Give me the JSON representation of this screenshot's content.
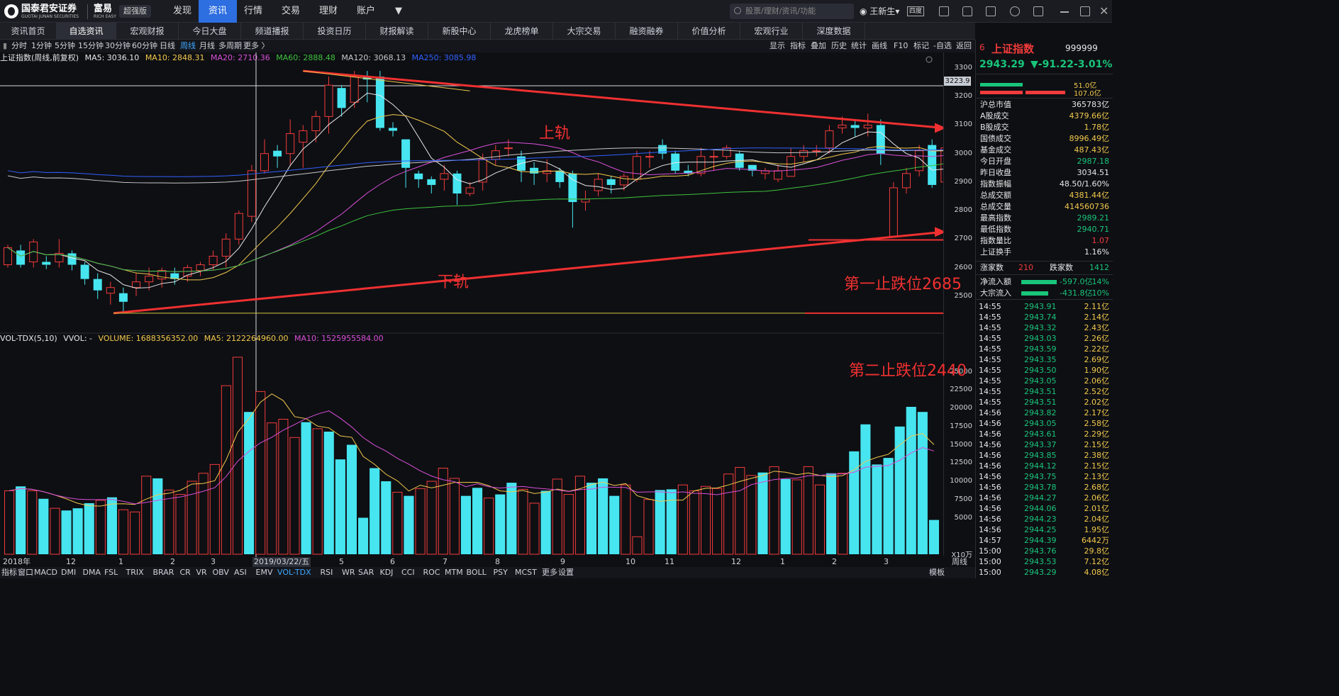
{
  "brand": {
    "name": "国泰君安证券",
    "sub": "GUOTAI JUNAN SECURITIES",
    "app": "富易",
    "app_sub": "RICH EASY",
    "edition": "超强版"
  },
  "top_menu": [
    "发现",
    "资讯",
    "行情",
    "交易",
    "理财",
    "账户"
  ],
  "search": {
    "placeholder": "股票/理财/资讯/功能"
  },
  "user": {
    "name": "王新生",
    "badge": "四度"
  },
  "sub_nav": [
    "资讯首页",
    "自选资讯",
    "宏观财报",
    "今日大盘",
    "频道播报",
    "投资日历",
    "财报解读",
    "新股中心",
    "龙虎榜单",
    "大宗交易",
    "融资融券",
    "价值分析",
    "宏观行业",
    "深度数据"
  ],
  "periods": [
    "分时",
    "1分钟",
    "5分钟",
    "15分钟",
    "30分钟",
    "60分钟",
    "日线",
    "周线",
    "月线",
    "多周期",
    "更多 〉"
  ],
  "right_tools": [
    "显示",
    "指标",
    "叠加",
    "历史",
    "统计",
    "画线",
    "F10",
    "标记",
    "-自选",
    "返回"
  ],
  "ma_line": {
    "title": "上证指数(周线,前复权)",
    "ma5": "MA5: 3036.10",
    "ma10": "MA10: 2848.31",
    "ma20": "MA20: 2710.36",
    "ma60": "MA60: 2888.48",
    "ma120": "MA120: 3068.13",
    "ma250": "MA250: 3085.98"
  },
  "price_badge": "3223.9",
  "y_ticks": [
    "3300",
    "3200",
    "3100",
    "3000",
    "2900",
    "2800",
    "2700",
    "2600",
    "2500"
  ],
  "vol_line": {
    "title": "VOL-TDX(5,10)",
    "vvol": "VVOL: -",
    "volume": "VOLUME: 1688356352.00",
    "ma5": "MA5: 2122264960.00",
    "ma10": "MA10: 1525955584.00"
  },
  "vol_ticks": [
    "25000",
    "22500",
    "20000",
    "17500",
    "15000",
    "12500",
    "10000",
    "7500",
    "5000"
  ],
  "vol_unit": "X10万",
  "x_ticks": [
    "2018年",
    "12",
    "1",
    "2",
    "3",
    "2019/03/22/五",
    "5",
    "6",
    "7",
    "8",
    "9",
    "10",
    "11",
    "12",
    "1",
    "2",
    "3"
  ],
  "x_right": "周线",
  "indicators": [
    "指标",
    "窗口",
    "MACD",
    "DMI",
    "DMA",
    "FSL",
    "TRIX",
    "BRAR",
    "CR",
    "VR",
    "OBV",
    "ASI",
    "EMV",
    "VOL-TDX",
    "RSI",
    "WR",
    "SAR",
    "KDJ",
    "CCI",
    "ROC",
    "MTM",
    "BOLL",
    "PSY",
    "MCST",
    "更多",
    "设置"
  ],
  "ind_right": "模板",
  "annotations": {
    "upper": "上轨",
    "lower": "下轨",
    "stop1": "第一止跌位2685",
    "stop2": "第二止跌位2440"
  },
  "quote": {
    "num": "6",
    "name": "上证指数",
    "code": "999999",
    "price": "2943.29",
    "change": "▼-91.22",
    "pct": "-3.01%",
    "bar1": "51.0亿",
    "bar2": "107.0亿"
  },
  "stats": [
    {
      "k": "沪总市值",
      "v": "365783亿",
      "c": "#e8e8e8"
    },
    {
      "k": "A股成交",
      "v": "4379.66亿",
      "c": "#f2c94c"
    },
    {
      "k": "B股成交",
      "v": "1.78亿",
      "c": "#f2c94c"
    },
    {
      "k": "国债成交",
      "v": "8996.49亿",
      "c": "#f2c94c"
    },
    {
      "k": "基金成交",
      "v": "487.43亿",
      "c": "#f2c94c"
    },
    {
      "k": "今日开盘",
      "v": "2987.18",
      "c": "#19c57b"
    },
    {
      "k": "昨日收盘",
      "v": "3034.51",
      "c": "#e8e8e8"
    },
    {
      "k": "指数振幅",
      "v": "48.50/1.60%",
      "c": "#e8e8e8"
    },
    {
      "k": "总成交额",
      "v": "4381.44亿",
      "c": "#f2c94c"
    },
    {
      "k": "总成交量",
      "v": "414560736",
      "c": "#f2c94c"
    },
    {
      "k": "最高指数",
      "v": "2989.21",
      "c": "#19c57b"
    },
    {
      "k": "最低指数",
      "v": "2940.71",
      "c": "#19c57b"
    },
    {
      "k": "指数量比",
      "v": "1.07",
      "c": "#f23b3b"
    },
    {
      "k": "上证换手",
      "v": "1.16%",
      "c": "#e8e8e8"
    }
  ],
  "updown": {
    "up_k": "涨家数",
    "up_v": "210",
    "down_k": "跌家数",
    "down_v": "1412"
  },
  "flows": [
    {
      "k": "净流入额",
      "v": "-597.0亿",
      "p": "-14%"
    },
    {
      "k": "大宗流入",
      "v": "-431.8亿",
      "p": "-10%"
    }
  ],
  "ticks": [
    [
      "14:55",
      "2943.91",
      "2.11亿"
    ],
    [
      "14:55",
      "2943.74",
      "2.14亿"
    ],
    [
      "14:55",
      "2943.32",
      "2.43亿"
    ],
    [
      "14:55",
      "2943.03",
      "2.26亿"
    ],
    [
      "14:55",
      "2943.59",
      "2.22亿"
    ],
    [
      "14:55",
      "2943.35",
      "2.69亿"
    ],
    [
      "14:55",
      "2943.50",
      "1.90亿"
    ],
    [
      "14:55",
      "2943.05",
      "2.06亿"
    ],
    [
      "14:55",
      "2943.51",
      "2.52亿"
    ],
    [
      "14:55",
      "2943.51",
      "2.02亿"
    ],
    [
      "14:56",
      "2943.82",
      "2.17亿"
    ],
    [
      "14:56",
      "2943.05",
      "2.58亿"
    ],
    [
      "14:56",
      "2943.61",
      "2.29亿"
    ],
    [
      "14:56",
      "2943.37",
      "2.15亿"
    ],
    [
      "14:56",
      "2943.85",
      "2.38亿"
    ],
    [
      "14:56",
      "2944.12",
      "2.15亿"
    ],
    [
      "14:56",
      "2943.75",
      "2.13亿"
    ],
    [
      "14:56",
      "2943.78",
      "2.68亿"
    ],
    [
      "14:56",
      "2944.27",
      "2.06亿"
    ],
    [
      "14:56",
      "2944.06",
      "2.01亿"
    ],
    [
      "14:56",
      "2944.23",
      "2.04亿"
    ],
    [
      "14:56",
      "2944.25",
      "1.95亿"
    ],
    [
      "14:57",
      "2944.39",
      "6442万"
    ],
    [
      "15:00",
      "2943.76",
      "29.8亿"
    ],
    [
      "15:00",
      "2943.53",
      "7.12亿"
    ],
    [
      "15:00",
      "2943.29",
      "4.08亿"
    ]
  ],
  "chart_data": {
    "type": "candlestick",
    "title": "上证指数(周线,前复权)",
    "ylim": [
      2385,
      3320
    ],
    "candles": [
      [
        2610,
        2670,
        2680,
        2600
      ],
      [
        2660,
        2610,
        2680,
        2600
      ],
      [
        2620,
        2690,
        2700,
        2600
      ],
      [
        2620,
        2610,
        2640,
        2595
      ],
      [
        2620,
        2650,
        2700,
        2600
      ],
      [
        2650,
        2610,
        2660,
        2590
      ],
      [
        2610,
        2560,
        2620,
        2540
      ],
      [
        2560,
        2520,
        2580,
        2490
      ],
      [
        2510,
        2530,
        2550,
        2470
      ],
      [
        2510,
        2480,
        2530,
        2440
      ],
      [
        2530,
        2550,
        2580,
        2500
      ],
      [
        2550,
        2570,
        2600,
        2520
      ],
      [
        2560,
        2590,
        2600,
        2530
      ],
      [
        2580,
        2560,
        2600,
        2540
      ],
      [
        2570,
        2600,
        2610,
        2550
      ],
      [
        2590,
        2610,
        2620,
        2570
      ],
      [
        2610,
        2640,
        2660,
        2590
      ],
      [
        2640,
        2700,
        2720,
        2600
      ],
      [
        2700,
        2790,
        2800,
        2680
      ],
      [
        2780,
        2940,
        2960,
        2760
      ],
      [
        2940,
        3000,
        3050,
        2930
      ],
      [
        3010,
        2990,
        3030,
        2950
      ],
      [
        3000,
        3070,
        3120,
        2960
      ],
      [
        3040,
        3080,
        3100,
        2950
      ],
      [
        3080,
        3130,
        3150,
        3040
      ],
      [
        3130,
        3240,
        3270,
        3070
      ],
      [
        3230,
        3160,
        3240,
        3130
      ],
      [
        3180,
        3270,
        3290,
        3160
      ],
      [
        3270,
        3260,
        3290,
        3180
      ],
      [
        3270,
        3090,
        3290,
        3080
      ],
      [
        3090,
        3080,
        3110,
        3060
      ],
      [
        3050,
        2950,
        3010,
        2880
      ],
      [
        2930,
        2910,
        2940,
        2880
      ],
      [
        2910,
        2890,
        2920,
        2860
      ],
      [
        2910,
        2930,
        2960,
        2870
      ],
      [
        2930,
        2860,
        2940,
        2820
      ],
      [
        2860,
        2880,
        2900,
        2850
      ],
      [
        2900,
        2980,
        3000,
        2870
      ],
      [
        2980,
        3010,
        3030,
        2960
      ],
      [
        3020,
        3020,
        3050,
        2990
      ],
      [
        2990,
        2940,
        3010,
        2900
      ],
      [
        2950,
        2930,
        2970,
        2890
      ],
      [
        2930,
        2940,
        2980,
        2900
      ],
      [
        2940,
        2900,
        2950,
        2880
      ],
      [
        2930,
        2830,
        2940,
        2740
      ],
      [
        2830,
        2840,
        2870,
        2800
      ],
      [
        2870,
        2910,
        2930,
        2850
      ],
      [
        2910,
        2890,
        2920,
        2860
      ],
      [
        2890,
        2920,
        2930,
        2870
      ],
      [
        2910,
        2990,
        3010,
        2900
      ],
      [
        2990,
        2990,
        3010,
        2950
      ],
      [
        3030,
        3000,
        3050,
        2980
      ],
      [
        3000,
        2940,
        3010,
        2930
      ],
      [
        2940,
        2930,
        2960,
        2920
      ],
      [
        2930,
        2990,
        3020,
        2920
      ],
      [
        2990,
        2990,
        3010,
        2940
      ],
      [
        2990,
        3020,
        3030,
        2980
      ],
      [
        3000,
        2950,
        3010,
        2940
      ],
      [
        2960,
        2940,
        2960,
        2920
      ],
      [
        2930,
        2940,
        2950,
        2910
      ],
      [
        2910,
        2940,
        2960,
        2900
      ],
      [
        2920,
        2990,
        3020,
        2920
      ],
      [
        2990,
        3010,
        3030,
        2970
      ],
      [
        3010,
        3010,
        3030,
        2990
      ],
      [
        3020,
        3080,
        3100,
        3000
      ],
      [
        3090,
        3100,
        3130,
        3070
      ],
      [
        3100,
        3090,
        3120,
        3060
      ],
      [
        3090,
        3100,
        3140,
        3060
      ],
      [
        3100,
        3000,
        3120,
        2960
      ],
      [
        2710,
        2880,
        2900,
        2710
      ],
      [
        2880,
        2930,
        2950,
        2860
      ],
      [
        2940,
        3010,
        3030,
        2920
      ],
      [
        3030,
        2890,
        3050,
        2880
      ],
      [
        2900,
        3020,
        3060,
        2900
      ],
      [
        2990,
        2960,
        3020,
        2940
      ]
    ],
    "volume_ylim": [
      0,
      27000
    ],
    "volume": [
      8700,
      9300,
      8700,
      7600,
      6300,
      6000,
      6300,
      7000,
      7400,
      7800,
      6100,
      5800,
      10700,
      10400,
      8800,
      8200,
      10000,
      11100,
      12300,
      23100,
      27000,
      19500,
      22300,
      18000,
      18500,
      16000,
      18100,
      17200,
      16800,
      13000,
      15000,
      5000,
      11800,
      10000,
      8500,
      8000,
      9000,
      10000,
      11800,
      10400,
      8000,
      9100,
      7700,
      8200,
      9800,
      8900,
      7000,
      8700,
      10300,
      8200,
      10700,
      9800,
      10400,
      8000,
      9500,
      2400,
      7500,
      8800,
      8900,
      9500,
      8700,
      9300,
      9000,
      11000,
      11900,
      10800,
      11200,
      12000,
      10300,
      10200,
      12000,
      9500,
      11100,
      11100,
      14100,
      17800,
      12300,
      13200,
      17500,
      20200,
      19500,
      4700
    ]
  }
}
